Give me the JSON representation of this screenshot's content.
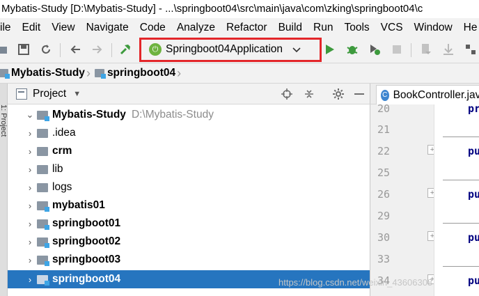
{
  "window": {
    "title": "Mybatis-Study [D:\\Mybatis-Study] - ...\\springboot04\\src\\main\\java\\com\\zking\\springboot04\\c"
  },
  "menu": [
    "ile",
    "Edit",
    "View",
    "Navigate",
    "Code",
    "Analyze",
    "Refactor",
    "Build",
    "Run",
    "Tools",
    "VCS",
    "Window",
    "He"
  ],
  "toolbar": {
    "run_config": "Springboot04Application",
    "highlight_color": "#e3262a"
  },
  "breadcrumb": [
    "Mybatis-Study",
    "springboot04"
  ],
  "side_strip": {
    "label": "1: Project"
  },
  "project_panel": {
    "title": "Project",
    "tree": [
      {
        "name": "Mybatis-Study",
        "path": "D:\\Mybatis-Study",
        "bold": true,
        "expanded": true,
        "module": true,
        "level": 0
      },
      {
        "name": ".idea",
        "bold": false,
        "module": false,
        "level": 1
      },
      {
        "name": "crm",
        "bold": true,
        "module": false,
        "level": 1
      },
      {
        "name": "lib",
        "bold": false,
        "module": false,
        "level": 1
      },
      {
        "name": "logs",
        "bold": false,
        "module": false,
        "level": 1
      },
      {
        "name": "mybatis01",
        "bold": true,
        "module": true,
        "level": 1
      },
      {
        "name": "springboot01",
        "bold": true,
        "module": true,
        "level": 1
      },
      {
        "name": "springboot02",
        "bold": true,
        "module": true,
        "level": 1
      },
      {
        "name": "springboot03",
        "bold": true,
        "module": true,
        "level": 1
      },
      {
        "name": "springboot04",
        "bold": true,
        "module": true,
        "level": 1,
        "selected": true
      }
    ],
    "selected_color": "#2675bf"
  },
  "editor": {
    "tab": "BookController.java",
    "line_numbers": [
      "20",
      "21",
      "22",
      "25",
      "26",
      "29",
      "30",
      "33",
      "34"
    ],
    "code_fragments": [
      "pri",
      "pu",
      "pu",
      "pu",
      "pu"
    ]
  },
  "watermark": "https://blog.csdn.net/weixin_43606308"
}
